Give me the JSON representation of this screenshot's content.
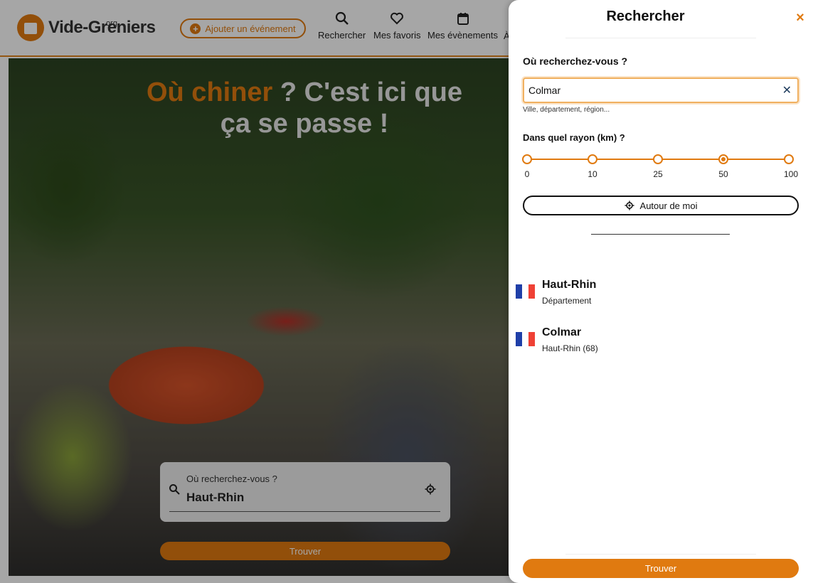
{
  "site": {
    "logo_text": "Vide-Greniers",
    "logo_sub": ".org",
    "add_event_label": "Ajouter un événement",
    "nav": [
      {
        "label": "Rechercher",
        "icon": "search-icon"
      },
      {
        "label": "Mes favoris",
        "icon": "heart-icon"
      },
      {
        "label": "Mes évènements",
        "icon": "calendar-icon"
      }
    ],
    "nav_partial": "À"
  },
  "hero": {
    "title_accent": "Où chiner",
    "title_rest": " ? C'est ici que",
    "title_line2": "ça se passe !",
    "search_label": "Où recherchez-vous ?",
    "search_value": "Haut-Rhin",
    "button_label": "Trouver"
  },
  "drawer": {
    "title": "Rechercher",
    "close_symbol": "×",
    "where_label": "Où recherchez-vous ?",
    "where_value": "Colmar",
    "where_hint": "Ville, département, région...",
    "radius_label": "Dans quel rayon (km) ?",
    "radius_options": [
      "0",
      "10",
      "25",
      "50",
      "100"
    ],
    "radius_selected": "50",
    "around_me_label": "Autour de moi",
    "results": [
      {
        "name": "Haut-Rhin",
        "sub": "Département"
      },
      {
        "name": "Colmar",
        "sub": "Haut-Rhin (68)"
      }
    ],
    "find_label": "Trouver"
  },
  "colors": {
    "accent": "#e07a10",
    "flag_blue": "#1f3fa8",
    "flag_white": "#ffffff",
    "flag_red": "#ef4135"
  }
}
